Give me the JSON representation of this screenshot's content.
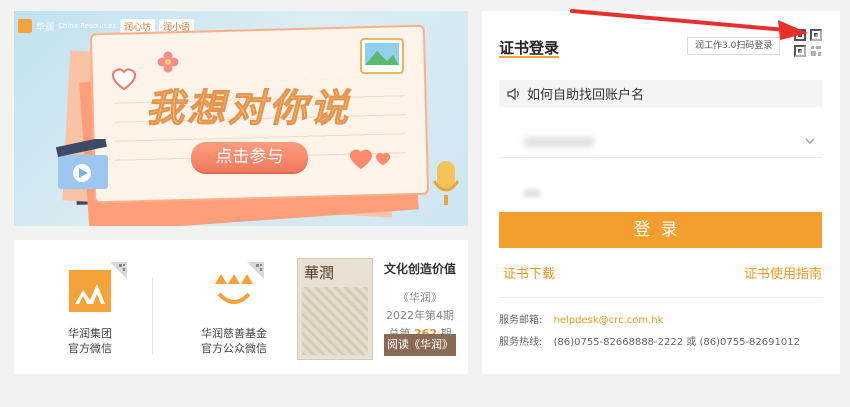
{
  "banner": {
    "logo_name": "华润",
    "logo_sub": "China Resources",
    "logo_tag1": "润心坊",
    "logo_tag2": "润小语",
    "title": "我想对你说",
    "join_label": "点击参与"
  },
  "wechat": {
    "items": [
      {
        "line1": "华润集团",
        "line2": "官方微信"
      },
      {
        "line1": "华润慈善基金",
        "line2": "官方公众微信"
      }
    ],
    "magazine": {
      "cover_head": "華潤",
      "title": "文化创造价值",
      "name": "《华润》",
      "issue": "2022年第4期",
      "total_prefix": "总第",
      "total_number": "262",
      "total_suffix": "期",
      "read_label": "阅读《华润》"
    }
  },
  "login": {
    "title": "证书登录",
    "qr_tip": "润工作3.0扫码登录",
    "notice": "如何自助找回账户名",
    "login_label": "登录",
    "cert_download": "证书下载",
    "cert_guide": "证书使用指南",
    "service_email_label": "服务邮箱:",
    "service_email": "helpdesk@crc.com.hk",
    "service_phone_label": "服务热线:",
    "service_phone": "(86)0755-82668888-2222 或 (86)0755-82691012"
  },
  "colors": {
    "accent": "#f49e2e",
    "link": "#f0951d",
    "arrow": "#e8302a"
  }
}
